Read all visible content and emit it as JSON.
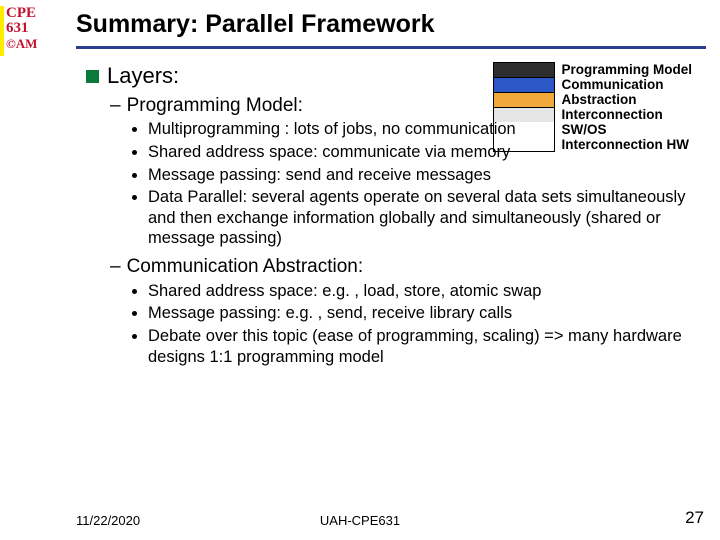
{
  "logo": {
    "line1": "CPE",
    "line2": "631",
    "line3": "©AM"
  },
  "title": "Summary: Parallel Framework",
  "legend": {
    "bars": [
      {
        "color": "#2e2e2e"
      },
      {
        "color": "#2c58c7"
      },
      {
        "color": "#f0a93a"
      },
      {
        "color": "#e6e6e6"
      }
    ],
    "lines": [
      "Programming Model",
      "Communication",
      "Abstraction",
      "Interconnection",
      "SW/OS",
      "Interconnection HW"
    ]
  },
  "body": {
    "h1": "Layers:",
    "sec1": {
      "heading": "Programming Model:",
      "items": [
        "Multiprogramming : lots of jobs, no communication",
        "Shared address space: communicate via memory",
        "Message passing: send and receive messages",
        "Data Parallel: several agents operate on several data sets simultaneously and then exchange information globally and simultaneously (shared or message passing)"
      ]
    },
    "sec2": {
      "heading": "Communication Abstraction:",
      "items": [
        "Shared address space: e.g. , load, store, atomic swap",
        "Message passing: e.g. , send, receive library calls",
        "Debate over this topic (ease of programming, scaling) => many hardware designs 1:1 programming model"
      ]
    }
  },
  "footer": {
    "date": "11/22/2020",
    "center": "UAH-CPE631",
    "page": "27"
  }
}
